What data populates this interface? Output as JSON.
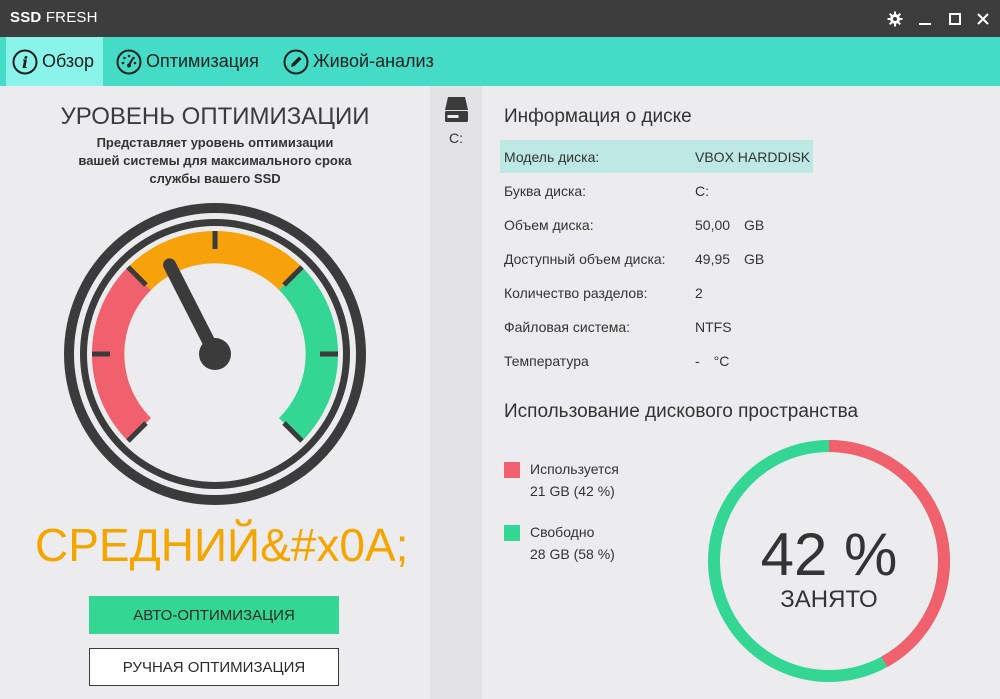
{
  "app": {
    "title_bold": "SSD",
    "title_rest": " FRESH"
  },
  "tabs": [
    {
      "label": "Обзор",
      "icon": "info-icon",
      "active": true
    },
    {
      "label": "Оптимизация",
      "icon": "speedometer-icon",
      "active": false
    },
    {
      "label": "Живой-анализ",
      "icon": "pencil-icon",
      "active": false
    }
  ],
  "optimization": {
    "title": "УРОВЕНЬ ОПТИМИЗАЦИИ",
    "description": "Представляет уровень оптимизации вашей системы для максимального срока службы вашего SSD",
    "level": "СРЕДНИЙ&#x0A;",
    "auto_button": "АВТО-ОПТИМИЗАЦИЯ",
    "manual_button": "РУЧНАЯ ОПТИМИЗАЦИЯ",
    "gauge_value": 0.4
  },
  "drive": {
    "letter": "C:"
  },
  "disk_info": {
    "title": "Информация о диске",
    "rows": [
      {
        "key": "Модель диска:",
        "value": "VBOX HARDDISK",
        "unit": ""
      },
      {
        "key": "Буква диска:",
        "value": "C:",
        "unit": ""
      },
      {
        "key": "Объем диска:",
        "value": "50,00",
        "unit": "GB"
      },
      {
        "key": "Доступный объем диска:",
        "value": "49,95",
        "unit": "GB"
      },
      {
        "key": "Количество разделов:",
        "value": "2",
        "unit": ""
      },
      {
        "key": "Файловая система:",
        "value": "NTFS",
        "unit": ""
      },
      {
        "key": "Температура",
        "value": "-",
        "unit": "°C"
      }
    ]
  },
  "usage": {
    "title": "Использование дискового пространства",
    "used_label": "Используется",
    "used_value": "21 GB (42 %)",
    "free_label": "Свободно",
    "free_value": "28 GB (58 %)",
    "percent_text": "42 %",
    "percent_label": "ЗАНЯТО",
    "used_fraction": 0.42,
    "used_color": "#f0606d",
    "free_color": "#34d693"
  }
}
